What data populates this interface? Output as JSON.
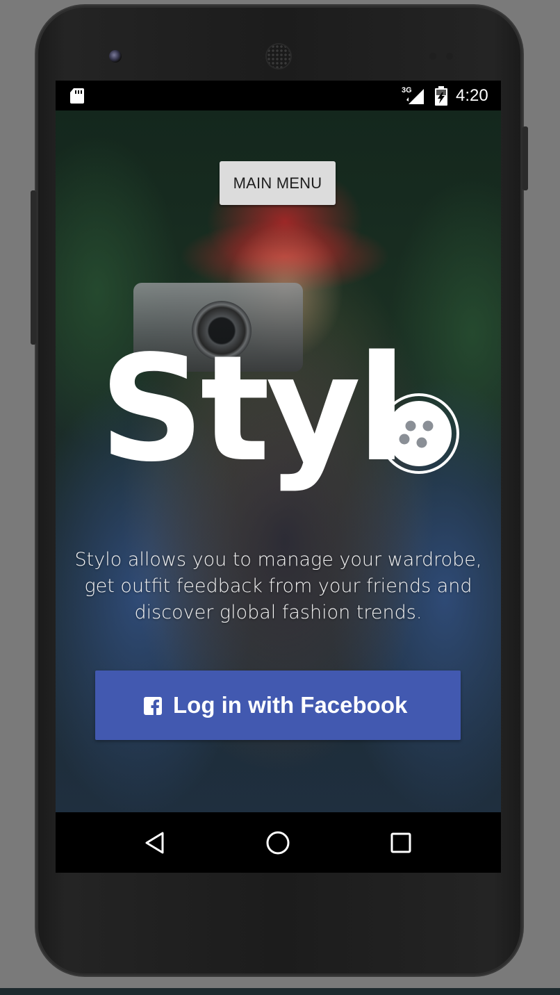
{
  "status_bar": {
    "network_type": "3G",
    "time": "4:20",
    "icons": [
      "sd-card-icon",
      "cell-signal-icon",
      "battery-charging-icon"
    ]
  },
  "app": {
    "main_menu_button_label": "MAIN MENU",
    "logo_text": "Styl",
    "logo_icon": "button-icon",
    "tagline": "Stylo allows you to manage your wardrobe, get outfit feedback from your friends and discover global fashion trends.",
    "facebook_button_label": "Log in with Facebook",
    "facebook_icon": "facebook-icon",
    "facebook_color": "#4259b0"
  },
  "navigation_bar": {
    "buttons": [
      "back-icon",
      "home-icon",
      "recents-icon"
    ]
  }
}
